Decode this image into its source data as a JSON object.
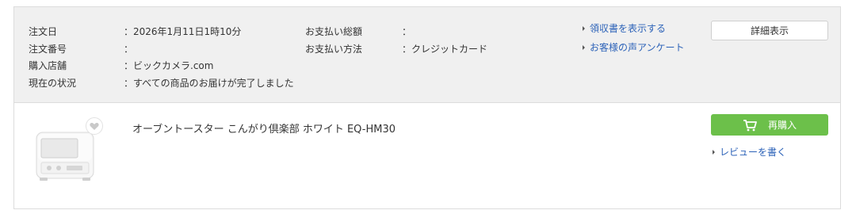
{
  "order": {
    "date_label": "注文日",
    "date_value": "：2026年1月11日1時10分",
    "number_label": "注文番号",
    "number_value": "：",
    "store_label": "購入店舗",
    "store_value": "：ビックカメラ.com",
    "status_label": "現在の状況",
    "status_value": "：すべての商品のお届けが完了しました",
    "total_label": "お支払い総額",
    "total_value": "：",
    "method_label": "お支払い方法",
    "method_value": "：クレジットカード"
  },
  "links": {
    "receipt": "領収書を表示する",
    "survey": "お客様の声アンケート",
    "review": "レビューを書く"
  },
  "buttons": {
    "detail": "詳細表示",
    "rebuy": "再購入"
  },
  "product": {
    "name": "オーブントースター こんがり倶楽部 ホワイト EQ-HM30"
  },
  "colors": {
    "accent_green": "#6cc04a",
    "link_blue": "#2c62b8",
    "header_bg": "#f0f0f0"
  },
  "icons": {
    "cart": "cart-icon",
    "heart": "heart-icon",
    "arrow": "triangle-right-icon"
  }
}
